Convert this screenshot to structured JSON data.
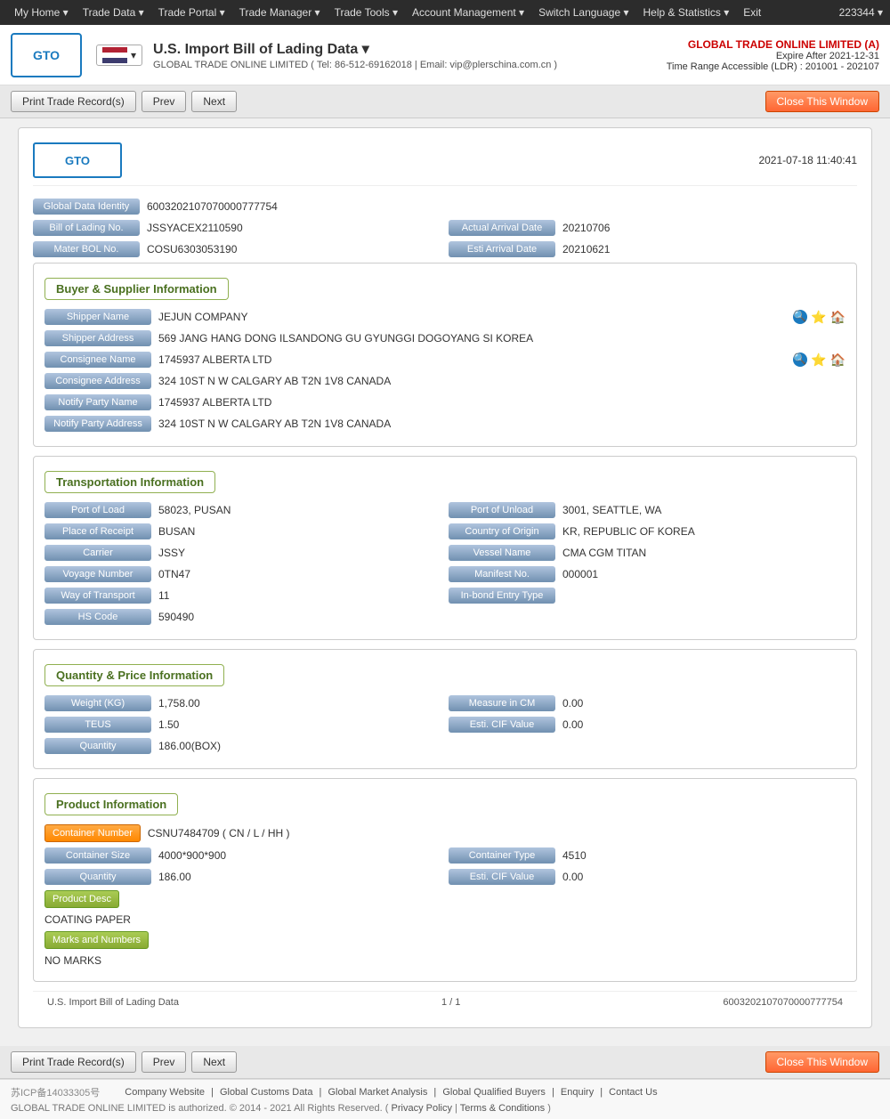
{
  "topnav": {
    "items": [
      {
        "label": "My Home ▾",
        "name": "my-home"
      },
      {
        "label": "Trade Data ▾",
        "name": "trade-data"
      },
      {
        "label": "Trade Portal ▾",
        "name": "trade-portal"
      },
      {
        "label": "Trade Manager ▾",
        "name": "trade-manager"
      },
      {
        "label": "Trade Tools ▾",
        "name": "trade-tools"
      },
      {
        "label": "Account Management ▾",
        "name": "account-management"
      },
      {
        "label": "Switch Language ▾",
        "name": "switch-language"
      },
      {
        "label": "Help & Statistics ▾",
        "name": "help-statistics"
      },
      {
        "label": "Exit",
        "name": "exit"
      }
    ],
    "user_id": "223344 ▾"
  },
  "header": {
    "logo": "GTO",
    "title": "U.S. Import Bill of Lading Data ▾",
    "subtitle": "GLOBAL TRADE ONLINE LIMITED ( Tel: 86-512-69162018  |  Email: vip@plerschina.com.cn )",
    "company": "GLOBAL TRADE ONLINE LIMITED (A)",
    "expire": "Expire After 2021-12-31",
    "ldr": "Time Range Accessible (LDR) : 201001 - 202107"
  },
  "toolbar": {
    "print_label": "Print Trade Record(s)",
    "prev_label": "Prev",
    "next_label": "Next",
    "close_label": "Close This Window"
  },
  "record": {
    "datetime": "2021-07-18 11:40:41",
    "logo": "GTO",
    "global_data_id_label": "Global Data Identity",
    "global_data_id_value": "6003202107070000777754",
    "bol_no_label": "Bill of Lading No.",
    "bol_no_value": "JSSYACEX2110590",
    "actual_arrival_date_label": "Actual Arrival Date",
    "actual_arrival_date_value": "20210706",
    "mater_bol_no_label": "Mater BOL No.",
    "mater_bol_no_value": "COSU6303053190",
    "esti_arrival_date_label": "Esti Arrival Date",
    "esti_arrival_date_value": "20210621"
  },
  "buyer_supplier": {
    "section_label": "Buyer & Supplier Information",
    "shipper_name_label": "Shipper Name",
    "shipper_name_value": "JEJUN COMPANY",
    "shipper_address_label": "Shipper Address",
    "shipper_address_value": "569 JANG HANG DONG ILSANDONG GU GYUNGGI DOGOYANG SI KOREA",
    "consignee_name_label": "Consignee Name",
    "consignee_name_value": "1745937 ALBERTA LTD",
    "consignee_address_label": "Consignee Address",
    "consignee_address_value": "324 10ST N W CALGARY AB T2N 1V8 CANADA",
    "notify_party_name_label": "Notify Party Name",
    "notify_party_name_value": "1745937 ALBERTA LTD",
    "notify_party_address_label": "Notify Party Address",
    "notify_party_address_value": "324 10ST N W CALGARY AB T2N 1V8 CANADA"
  },
  "transportation": {
    "section_label": "Transportation Information",
    "port_of_load_label": "Port of Load",
    "port_of_load_value": "58023, PUSAN",
    "port_of_unload_label": "Port of Unload",
    "port_of_unload_value": "3001, SEATTLE, WA",
    "place_of_receipt_label": "Place of Receipt",
    "place_of_receipt_value": "BUSAN",
    "country_of_origin_label": "Country of Origin",
    "country_of_origin_value": "KR, REPUBLIC OF KOREA",
    "carrier_label": "Carrier",
    "carrier_value": "JSSY",
    "vessel_name_label": "Vessel Name",
    "vessel_name_value": "CMA CGM TITAN",
    "voyage_number_label": "Voyage Number",
    "voyage_number_value": "0TN47",
    "manifest_no_label": "Manifest No.",
    "manifest_no_value": "000001",
    "way_of_transport_label": "Way of Transport",
    "way_of_transport_value": "11",
    "in_bond_entry_type_label": "In-bond Entry Type",
    "in_bond_entry_type_value": "",
    "hs_code_label": "HS Code",
    "hs_code_value": "590490"
  },
  "quantity_price": {
    "section_label": "Quantity & Price Information",
    "weight_kg_label": "Weight (KG)",
    "weight_kg_value": "1,758.00",
    "measure_in_cm_label": "Measure in CM",
    "measure_in_cm_value": "0.00",
    "teus_label": "TEUS",
    "teus_value": "1.50",
    "esti_cif_value_label": "Esti. CIF Value",
    "esti_cif_value_value": "0.00",
    "quantity_label": "Quantity",
    "quantity_value": "186.00(BOX)"
  },
  "product": {
    "section_label": "Product Information",
    "container_number_label": "Container Number",
    "container_number_value": "CSNU7484709 ( CN / L / HH )",
    "container_size_label": "Container Size",
    "container_size_value": "4000*900*900",
    "container_type_label": "Container Type",
    "container_type_value": "4510",
    "quantity_label": "Quantity",
    "quantity_value": "186.00",
    "esti_cif_value_label": "Esti. CIF Value",
    "esti_cif_value_value": "0.00",
    "product_desc_label": "Product Desc",
    "product_desc_value": "COATING PAPER",
    "marks_and_numbers_label": "Marks and Numbers",
    "marks_and_numbers_value": "NO MARKS"
  },
  "bottom_bar": {
    "record_label": "U.S. Import Bill of Lading Data",
    "page_info": "1 / 1",
    "record_id": "6003202107070000777754"
  },
  "footer": {
    "icp": "苏ICP备14033305号",
    "links": [
      "Company Website",
      "Global Customs Data",
      "Global Market Analysis",
      "Global Qualified Buyers",
      "Enquiry",
      "Contact Us"
    ],
    "copyright": "GLOBAL TRADE ONLINE LIMITED is authorized. © 2014 - 2021 All Rights Reserved.",
    "privacy_policy": "Privacy Policy",
    "terms": "Terms & Conditions"
  }
}
